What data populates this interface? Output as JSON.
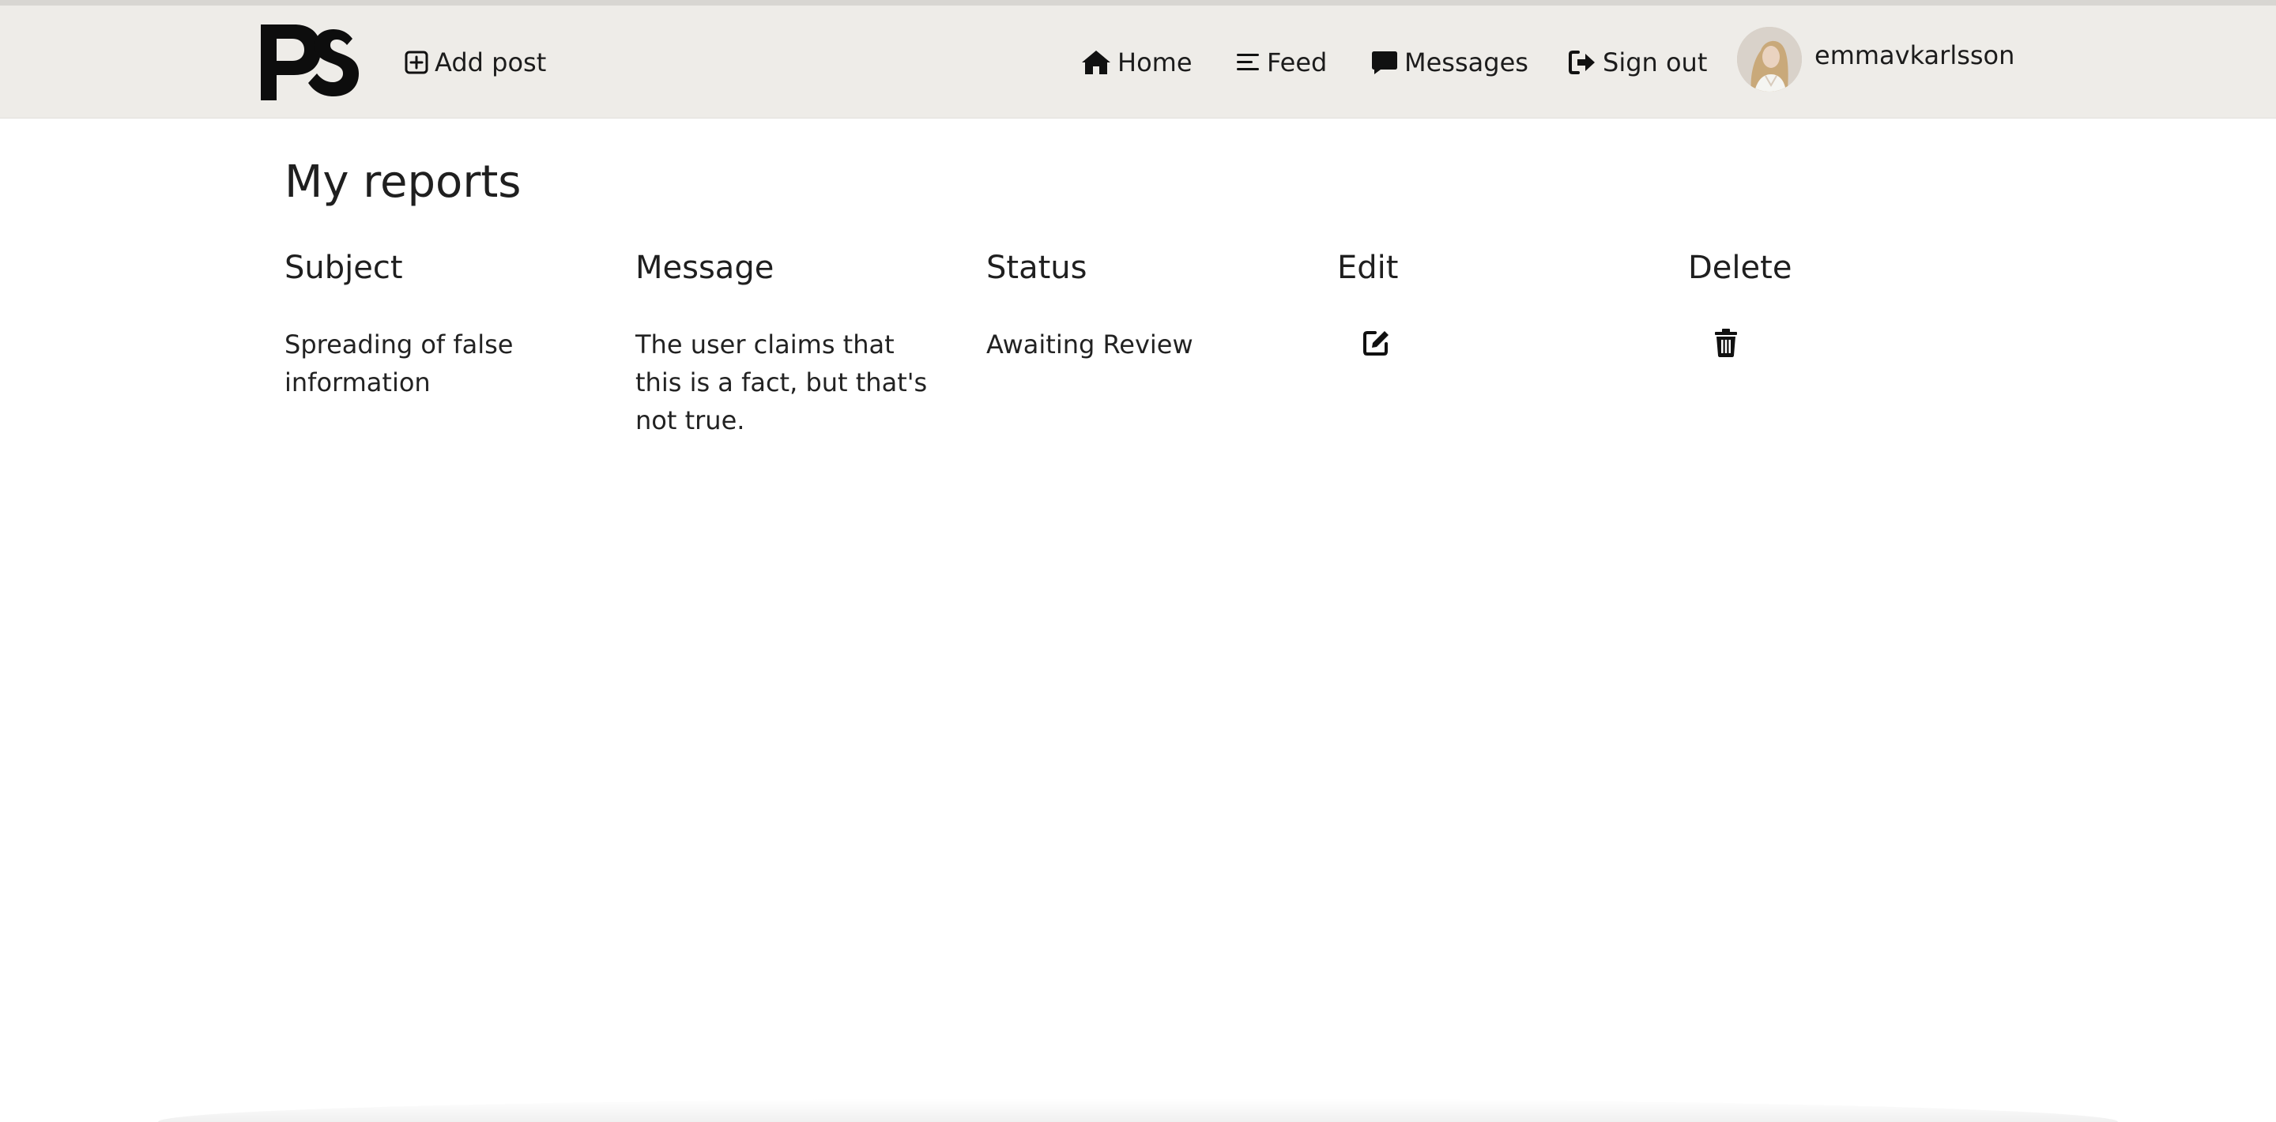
{
  "nav": {
    "logo_text": "PS",
    "add_post": "Add post",
    "home": "Home",
    "feed": "Feed",
    "messages": "Messages",
    "sign_out": "Sign out",
    "username": "emmavkarlsson"
  },
  "page": {
    "title": "My reports"
  },
  "table": {
    "headers": [
      "Subject",
      "Message",
      "Status",
      "Edit",
      "Delete"
    ],
    "rows": [
      {
        "subject": "Spreading of false information",
        "message": "The user claims that this is a fact, but that's not true.",
        "status": "Awaiting Review",
        "edit_icon": "edit-icon",
        "delete_icon": "trash-icon"
      }
    ]
  },
  "colors": {
    "navbar_bg": "#eeece8",
    "text": "#222222",
    "icon": "#111111"
  }
}
